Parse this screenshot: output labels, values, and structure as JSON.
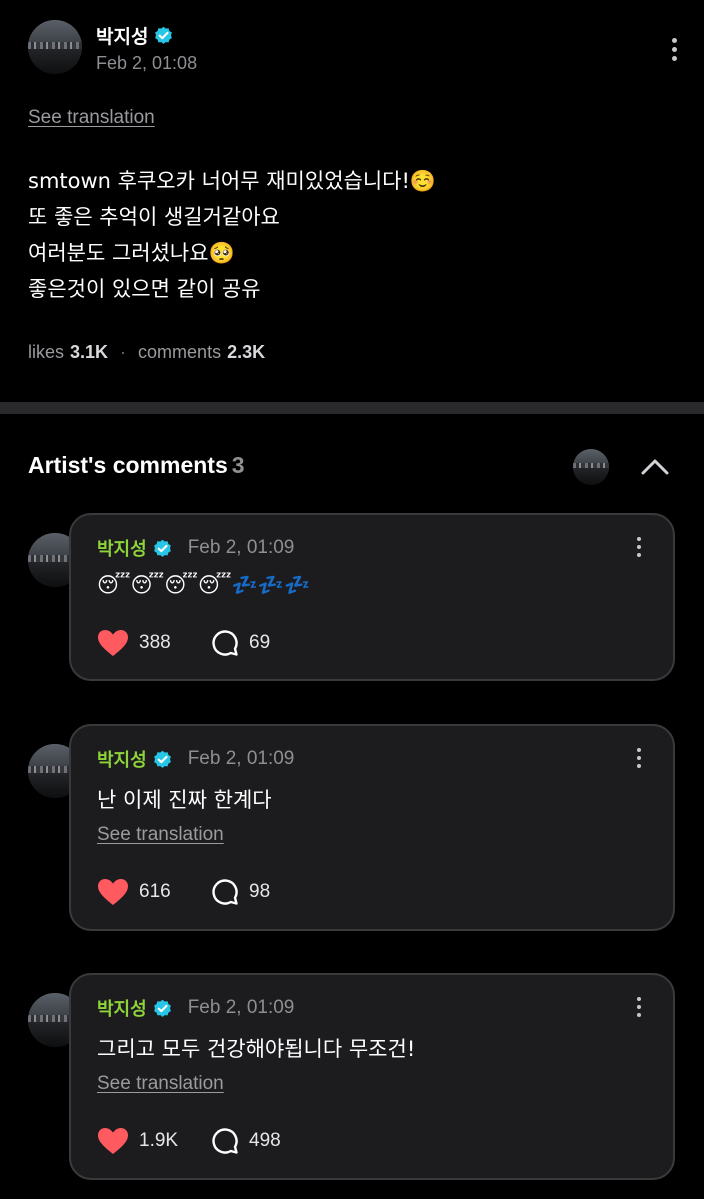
{
  "post": {
    "author": "박지성",
    "timestamp": "Feb 2, 01:08",
    "see_translation": "See translation",
    "lines": [
      "smtown 후쿠오카 너어무 재미있었습니다!☺️",
      "또 좋은 추억이 생길거같아요",
      "여러분도 그러셨나요🥺",
      "좋은것이 있으면 같이 공유"
    ],
    "likes_label": "likes",
    "likes_count": "3.1K",
    "comments_label": "comments",
    "comments_count": "2.3K",
    "separator": "·"
  },
  "section": {
    "title": "Artist's comments",
    "count": "3"
  },
  "comments": [
    {
      "author": "박지성",
      "timestamp": "Feb 2, 01:09",
      "text": "😴😴😴😴💤💤💤",
      "see_translation": "",
      "likes": "388",
      "replies": "69"
    },
    {
      "author": "박지성",
      "timestamp": "Feb 2, 01:09",
      "text": "난 이제 진짜 한계다",
      "see_translation": "See translation",
      "likes": "616",
      "replies": "98"
    },
    {
      "author": "박지성",
      "timestamp": "Feb 2, 01:09",
      "text": "그리고 모두 건강해야됩니다 무조건!",
      "see_translation": "See translation",
      "likes": "1.9K",
      "replies": "498"
    }
  ],
  "colors": {
    "background": "#000000",
    "card": "#1c1c1e",
    "card_border": "#3a3a3c",
    "accent_name": "#8ed33a",
    "verified": "#27c5e6",
    "heart": "#ff5a5f",
    "muted_text": "#8e8e93"
  },
  "icons": {
    "verified": "verified-badge-icon",
    "more": "more-vertical-icon",
    "collapse": "chevron-up-icon",
    "like": "heart-icon",
    "reply": "chat-bubble-icon"
  }
}
